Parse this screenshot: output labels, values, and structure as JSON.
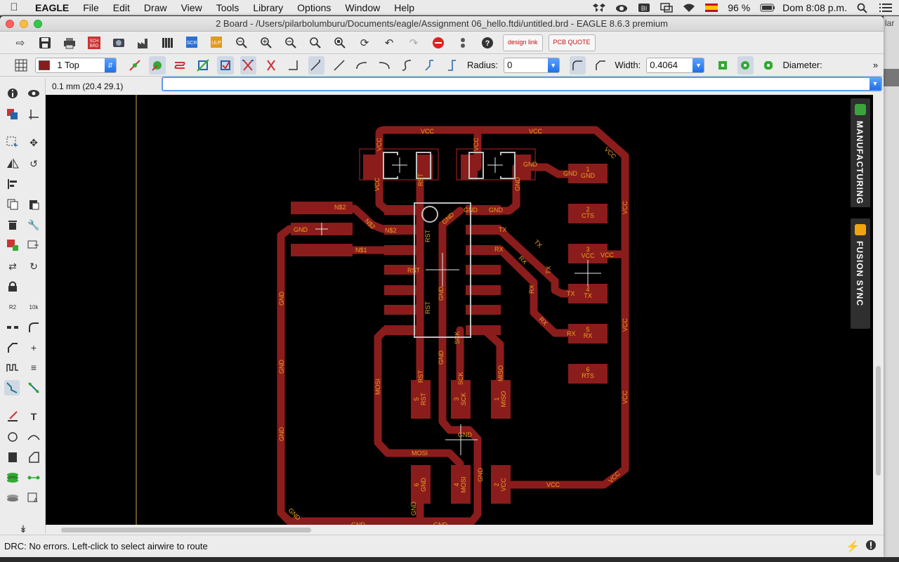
{
  "menubar": {
    "app_name": "EAGLE",
    "items": [
      "File",
      "Edit",
      "Draw",
      "View",
      "Tools",
      "Library",
      "Options",
      "Window",
      "Help"
    ],
    "battery": "96 %",
    "clock": "Dom 8:08 p.m."
  },
  "window": {
    "title": "2 Board - /Users/pilarbolumburu/Documents/eagle/Assignment 06_hello.ftdi/untitled.brd - EAGLE 8.6.3 premium"
  },
  "toolbar": {
    "design_link": "design link",
    "pcb_quote": "PCB QUOTE"
  },
  "paramsbar": {
    "layer": "1 Top",
    "radius_label": "Radius:",
    "radius_value": "0",
    "width_label": "Width:",
    "width_value": "0.4064",
    "diameter_label": "Diameter:"
  },
  "cmdrow": {
    "coordinate": "0.1 mm (20.4 29.1)",
    "command_value": ""
  },
  "side_panels": {
    "manufacturing": "MANUFACTURING",
    "fusion_sync": "FUSION SYNC"
  },
  "status": {
    "message": "DRC: No errors. Left-click to select airwire to route"
  },
  "behind_window_text": "lar",
  "board": {
    "colors": {
      "copper": "#8b1c1c",
      "text": "#e8a321",
      "outline": "#c0c0c0",
      "background": "#000000"
    },
    "pad_labels": {
      "ftdi": [
        {
          "num": "1",
          "name": "GND"
        },
        {
          "num": "2",
          "name": "CTS"
        },
        {
          "num": "3",
          "name": "VCC"
        },
        {
          "num": "4",
          "name": "TX"
        },
        {
          "num": "5",
          "name": "RX"
        },
        {
          "num": "6",
          "name": "RTS"
        }
      ],
      "isp_top": [
        {
          "num": "5",
          "name": "RST"
        },
        {
          "num": "3",
          "name": "SCK"
        },
        {
          "num": "1",
          "name": "MISO"
        }
      ],
      "isp_bottom": [
        {
          "num": "6",
          "name": "GND"
        },
        {
          "num": "4",
          "name": "MOSI"
        },
        {
          "num": "2",
          "name": "VCC"
        }
      ]
    },
    "net_labels": {
      "vcc": "VCC",
      "gnd": "GND",
      "rst": "RST",
      "tx": "TX",
      "rx": "RX",
      "mosi": "MOSI",
      "miso": "MISO",
      "sck": "SCK",
      "n51": "N$1",
      "n52": "N$2"
    }
  }
}
